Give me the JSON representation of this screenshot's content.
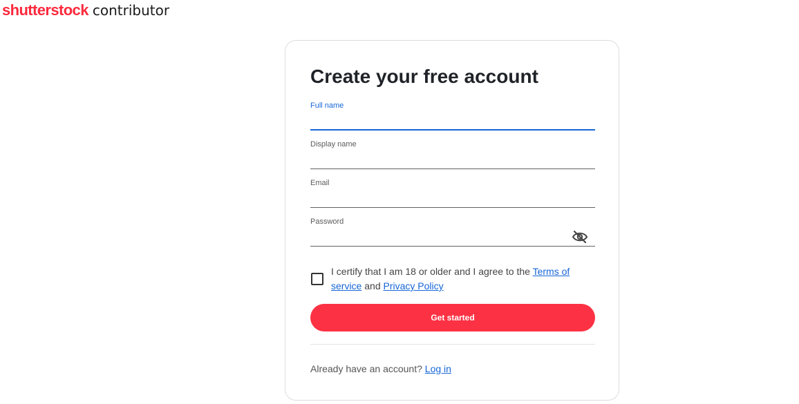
{
  "brand": {
    "name": "shutterstock",
    "product": "contributor",
    "accent_color": "#fc2a3d"
  },
  "form": {
    "title": "Create your free account",
    "fields": [
      {
        "label": "Full name",
        "value": "",
        "active": true
      },
      {
        "label": "Display name",
        "value": ""
      },
      {
        "label": "Email",
        "value": ""
      },
      {
        "label": "Password",
        "value": "",
        "icon": "eye-slash-icon"
      }
    ],
    "consent": {
      "checked": false,
      "text_before": "I certify that I am 18 or older and I agree to the",
      "terms_link": "Terms of service",
      "text_and": "and",
      "privacy_link": "Privacy Policy"
    },
    "submit_label": "Get started",
    "submit_color": "#fc3244",
    "login_prompt": "Already have an account?",
    "login_link": "Log in",
    "link_color": "#1565d8"
  }
}
